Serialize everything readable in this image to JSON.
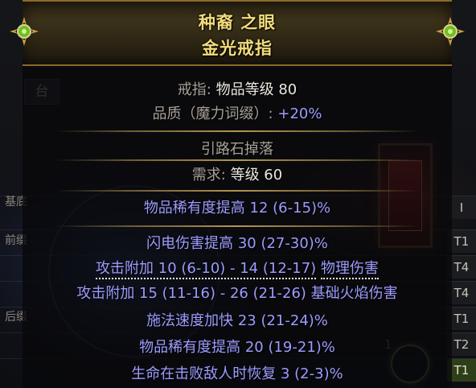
{
  "background": {
    "tab_label": "台",
    "side_labels": [
      "基底",
      "前缀",
      "后缀"
    ],
    "tiers": [
      "I",
      "T1",
      "T4",
      "T4",
      "T1",
      "T2",
      "T1"
    ],
    "stray_number": "1"
  },
  "item": {
    "name": "种裔 之眼",
    "base_type": "金光戒指",
    "header_color": "#f2dc7a",
    "item_class_label": "戒指:",
    "item_level_label": "物品等级",
    "item_level": "80",
    "quality_label": "品质（魔力词缀）:",
    "quality_value": "+20%",
    "source": "引路石掉落",
    "requirement_label": "需求:",
    "requirement_value": "等级 60",
    "implicit": "物品稀有度提高 12 (6-15)%",
    "explicit_mods": [
      {
        "text": "闪电伤害提高 30 (27-30)%"
      },
      {
        "prefix": "攻击附加 10 (6-10) - 14 (12-17)",
        "suffix": "物理伤害"
      },
      {
        "text": "攻击附加 15 (11-16) - 26 (21-26) 基础火焰伤害"
      },
      {
        "text": "施法速度加快 23 (21-24)%"
      },
      {
        "text": "物品稀有度提高 20 (19-21)%"
      },
      {
        "text": "生命在击败敌人时恢复 3 (2-3)%"
      }
    ],
    "magic_color": "#9e9cff"
  }
}
